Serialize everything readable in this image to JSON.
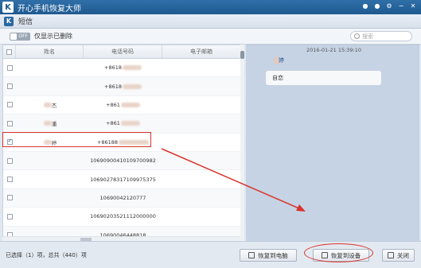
{
  "app": {
    "title": "开心手机恢复大师",
    "logo": "K"
  },
  "subwindow": {
    "title": "短信",
    "logo": "K"
  },
  "toolbar": {
    "toggle_text": "OFF",
    "toggle_label": "仅显示已删除",
    "search_placeholder": "搜索"
  },
  "table": {
    "headers": [
      "姓名",
      "电话号码",
      "电子邮箱"
    ],
    "rows": [
      {
        "checked": false,
        "name": "",
        "phone": "+8618",
        "email": "",
        "orange": true
      },
      {
        "checked": false,
        "name": "",
        "phone": "+8618",
        "email": "",
        "orange": true
      },
      {
        "checked": false,
        "name": "杰",
        "phone": "+861",
        "email": "",
        "orange": true
      },
      {
        "checked": false,
        "name": "潘",
        "phone": "+861",
        "email": "",
        "orange": true
      },
      {
        "checked": true,
        "name": "婷",
        "phone": "+86188",
        "email": "",
        "orange": false
      },
      {
        "checked": false,
        "name": "",
        "phone": "106909004101097009​82",
        "email": "",
        "orange": false
      },
      {
        "checked": false,
        "name": "",
        "phone": "10690278317109975375",
        "email": "",
        "orange": false
      },
      {
        "checked": false,
        "name": "",
        "phone": "10690042120777",
        "email": "",
        "orange": false
      },
      {
        "checked": false,
        "name": "",
        "phone": "106902035211120000​00",
        "email": "",
        "orange": false
      },
      {
        "checked": false,
        "name": "",
        "phone": "10690046448818",
        "email": "",
        "orange": false
      }
    ]
  },
  "message": {
    "time": "2016-01-21 15:39:10",
    "avatar_label": "婷",
    "text": "自恋"
  },
  "status": {
    "text": "已选择（1）项，总共（440）项"
  },
  "buttons": {
    "recover_pc": "恢复到电脑",
    "recover_device": "恢复到设备",
    "close": "关闭"
  },
  "colors": {
    "accent": "#1f5a91",
    "highlight": "#d9342b",
    "orange": "#e8742b",
    "chat_bg": "#c5d3e4"
  }
}
